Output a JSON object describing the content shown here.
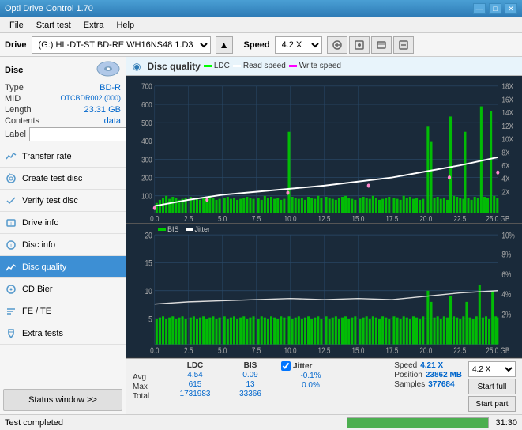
{
  "titlebar": {
    "title": "Opti Drive Control 1.70",
    "minimize": "—",
    "maximize": "□",
    "close": "✕"
  },
  "menubar": {
    "items": [
      "File",
      "Start test",
      "Extra",
      "Help"
    ]
  },
  "drivebar": {
    "drive_label": "Drive",
    "drive_value": "(G:) HL-DT-ST BD-RE  WH16NS48 1.D3",
    "speed_label": "Speed",
    "speed_value": "4.2 X"
  },
  "disc": {
    "title": "Disc",
    "type_label": "Type",
    "type_value": "BD-R",
    "mid_label": "MID",
    "mid_value": "OTCBDR002 (000)",
    "length_label": "Length",
    "length_value": "23.31 GB",
    "contents_label": "Contents",
    "contents_value": "data",
    "label_label": "Label",
    "label_placeholder": ""
  },
  "nav": {
    "items": [
      {
        "id": "transfer-rate",
        "label": "Transfer rate",
        "icon": "chart"
      },
      {
        "id": "create-test-disc",
        "label": "Create test disc",
        "icon": "disc"
      },
      {
        "id": "verify-test-disc",
        "label": "Verify test disc",
        "icon": "check"
      },
      {
        "id": "drive-info",
        "label": "Drive info",
        "icon": "info"
      },
      {
        "id": "disc-info",
        "label": "Disc info",
        "icon": "disc-info"
      },
      {
        "id": "disc-quality",
        "label": "Disc quality",
        "icon": "quality",
        "active": true
      },
      {
        "id": "cd-bier",
        "label": "CD Bier",
        "icon": "cd"
      },
      {
        "id": "fe-te",
        "label": "FE / TE",
        "icon": "fe"
      },
      {
        "id": "extra-tests",
        "label": "Extra tests",
        "icon": "extra"
      }
    ],
    "status_btn": "Status window >>"
  },
  "chart": {
    "title": "Disc quality",
    "legend": {
      "ldc": "LDC",
      "read_speed": "Read speed",
      "write_speed": "Write speed"
    },
    "upper": {
      "y_max": 700,
      "y_labels_left": [
        "700",
        "600",
        "500",
        "400",
        "300",
        "200",
        "100"
      ],
      "y_labels_right": [
        "18X",
        "16X",
        "14X",
        "12X",
        "10X",
        "8X",
        "6X",
        "4X",
        "2X"
      ],
      "x_labels": [
        "0.0",
        "2.5",
        "5.0",
        "7.5",
        "10.0",
        "12.5",
        "15.0",
        "17.5",
        "20.0",
        "22.5",
        "25.0 GB"
      ]
    },
    "lower": {
      "title_bis": "BIS",
      "title_jitter": "Jitter",
      "y_max": 20,
      "y_labels_left": [
        "20",
        "15",
        "10",
        "5"
      ],
      "y_labels_right": [
        "10%",
        "8%",
        "6%",
        "4%",
        "2%"
      ],
      "x_labels": [
        "0.0",
        "2.5",
        "5.0",
        "7.5",
        "10.0",
        "12.5",
        "15.0",
        "17.5",
        "20.0",
        "22.5",
        "25.0 GB"
      ]
    }
  },
  "stats": {
    "col_ldc": "LDC",
    "col_bis": "BIS",
    "col_jitter": "Jitter",
    "avg_label": "Avg",
    "max_label": "Max",
    "total_label": "Total",
    "avg_ldc": "4.54",
    "avg_bis": "0.09",
    "avg_jitter": "-0.1%",
    "max_ldc": "615",
    "max_bis": "13",
    "max_jitter": "0.0%",
    "total_ldc": "1731983",
    "total_bis": "33366",
    "speed_label": "Speed",
    "speed_value": "4.21 X",
    "position_label": "Position",
    "position_value": "23862 MB",
    "samples_label": "Samples",
    "samples_value": "377684",
    "speed_dropdown": "4.2 X",
    "start_full": "Start full",
    "start_part": "Start part",
    "jitter_checked": true
  },
  "statusbar": {
    "text": "Test completed",
    "progress": 100,
    "time": "31:30"
  }
}
